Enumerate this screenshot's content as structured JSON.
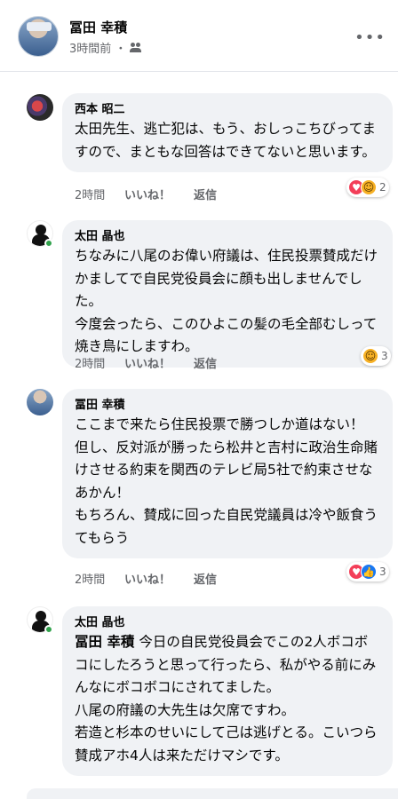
{
  "post": {
    "author": "冨田 幸積",
    "time": "3時間前 ・"
  },
  "comments": [
    {
      "name": "西本 昭二",
      "text": "太田先生、逃亡犯は、もう、おしっこちびってますので、まともな回答はできてないと思います。",
      "time": "2時間",
      "like": "いいね！",
      "reply": "返信",
      "reaction_count": "2"
    },
    {
      "name": "太田 晶也",
      "text": "ちなみに八尾のお偉い府議は、住民投票賛成だけかましてで自民党役員会に顔も出しませんでした。\n今度会ったら、このひよこの髪の毛全部むしって焼き鳥にしますわ。",
      "time": "2時間",
      "like": "いいね！",
      "reply": "返信",
      "reaction_count": "3"
    },
    {
      "name": "冨田 幸積",
      "text": "ここまで来たら住民投票で勝つしか道はない！\n但し、反対派が勝ったら松井と吉村に政治生命賭けさせる約束を関西のテレビ局5社で約束させなあかん！\nもちろん、賛成に回った自民党議員は冷や飯食うてもらう",
      "time": "2時間",
      "like": "いいね！",
      "reply": "返信",
      "reaction_count": "3"
    },
    {
      "name": "太田 晶也",
      "mention": "冨田 幸積",
      "text": " 今日の自民党役員会でこの2人ボコボコにしたろうと思って行ったら、私がやる前にみんなにボコボコにされてました。\n八尾の府議の大先生は欠席ですわ。\n若造と杉本のせいにして己は逃げとる。こいつら賛成アホ4人は来ただけマシです。"
    }
  ]
}
